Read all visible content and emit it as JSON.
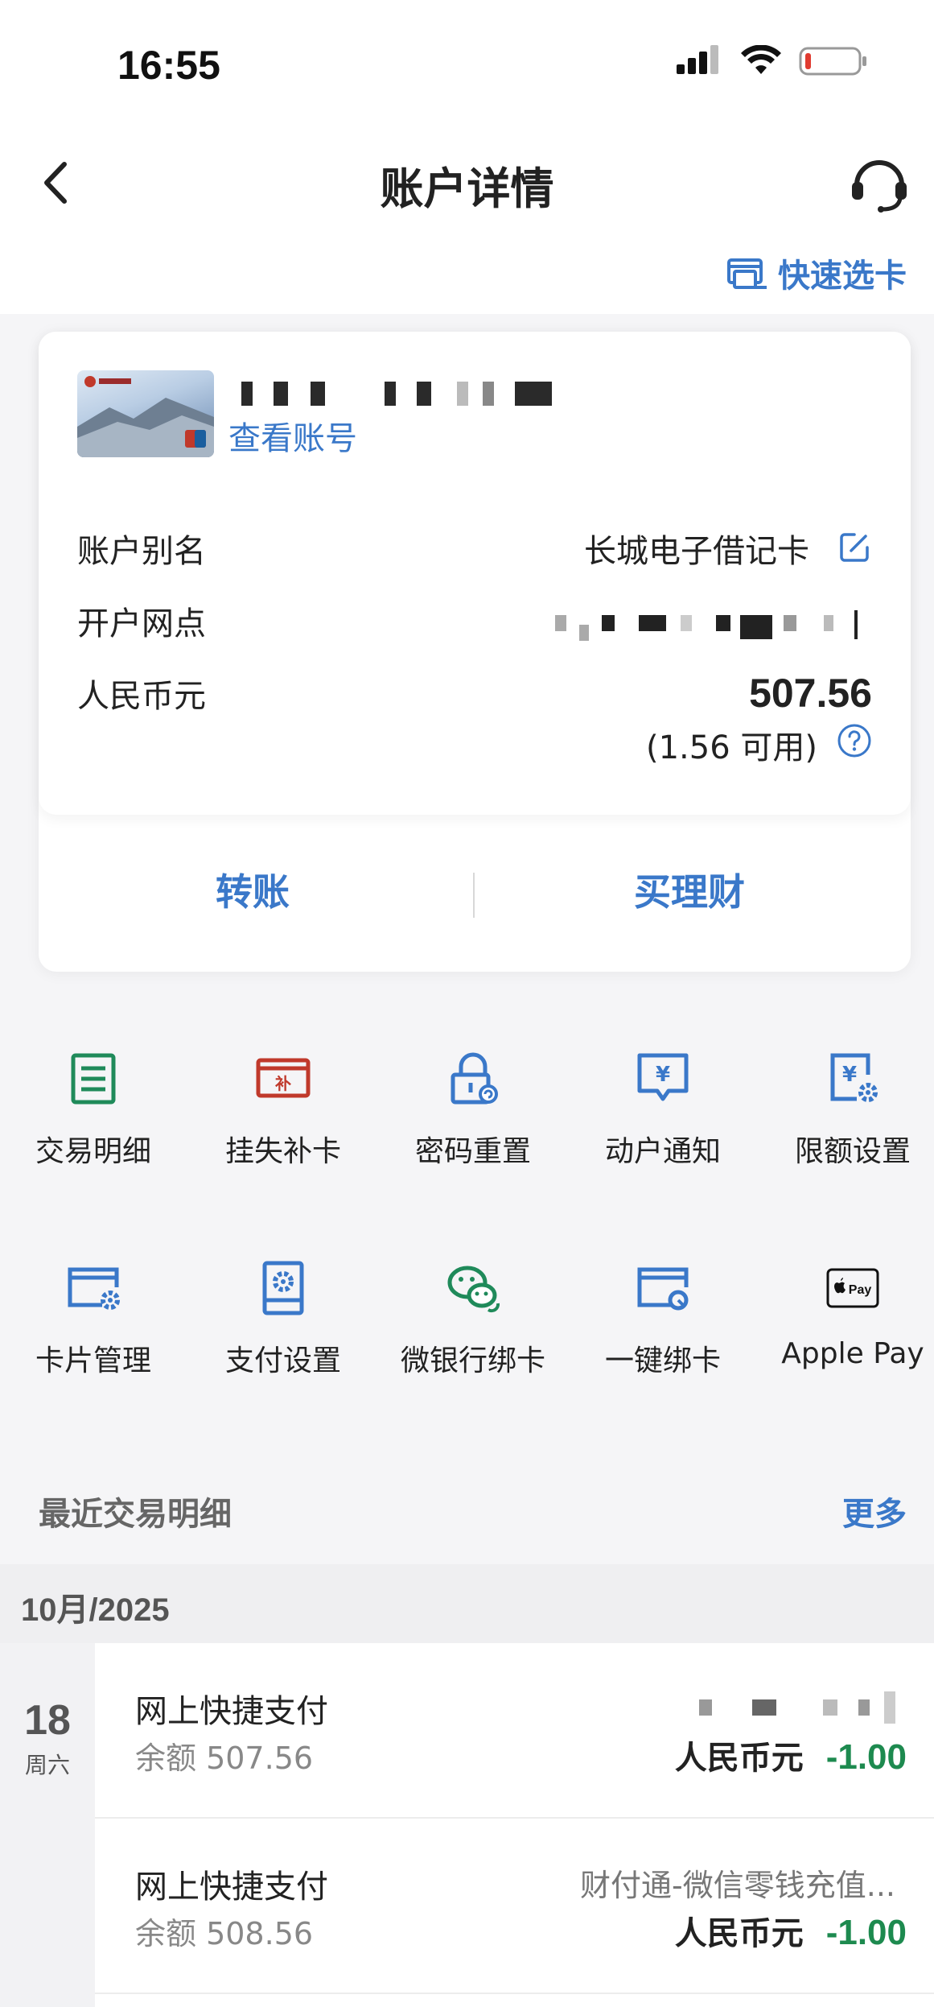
{
  "status_bar": {
    "time": "16:55"
  },
  "header": {
    "title": "账户详情"
  },
  "quick_select": {
    "label": "快速选卡"
  },
  "card": {
    "view_account_label": "查看账号",
    "alias_label": "账户别名",
    "alias_value": "长城电子借记卡",
    "branch_label": "开户网点",
    "currency_label": "人民币元",
    "balance": "507.56",
    "available": "(1.56 可用)"
  },
  "actions": {
    "transfer": "转账",
    "buy_wealth": "买理财"
  },
  "services": [
    {
      "label": "交易明细",
      "icon": "list-document-icon",
      "color": "#1f8a5a"
    },
    {
      "label": "挂失补卡",
      "icon": "card-replace-icon",
      "color": "#c0392b"
    },
    {
      "label": "密码重置",
      "icon": "lock-reset-icon",
      "color": "#3a78c9"
    },
    {
      "label": "动户通知",
      "icon": "yuan-notice-icon",
      "color": "#3a78c9"
    },
    {
      "label": "限额设置",
      "icon": "yuan-settings-icon",
      "color": "#3a78c9"
    },
    {
      "label": "卡片管理",
      "icon": "card-settings-icon",
      "color": "#3a78c9"
    },
    {
      "label": "支付设置",
      "icon": "payment-settings-icon",
      "color": "#3a78c9"
    },
    {
      "label": "微银行绑卡",
      "icon": "wechat-icon",
      "color": "#1f8a5a"
    },
    {
      "label": "一键绑卡",
      "icon": "card-bind-icon",
      "color": "#3a78c9"
    },
    {
      "label": "Apple Pay",
      "icon": "apple-pay-icon",
      "color": "#111111"
    }
  ],
  "recent": {
    "title": "最近交易明细",
    "more": "更多",
    "month": "10月/2025",
    "date_day": "18",
    "date_weekday": "周六",
    "transactions": [
      {
        "title": "网上快捷支付",
        "balance": "余额 507.56",
        "counterparty": "",
        "currency": "人民币元",
        "amount": "-1.00"
      },
      {
        "title": "网上快捷支付",
        "balance": "余额 508.56",
        "counterparty": "财付通-微信零钱充值...",
        "currency": "人民币元",
        "amount": "-1.00"
      }
    ]
  }
}
